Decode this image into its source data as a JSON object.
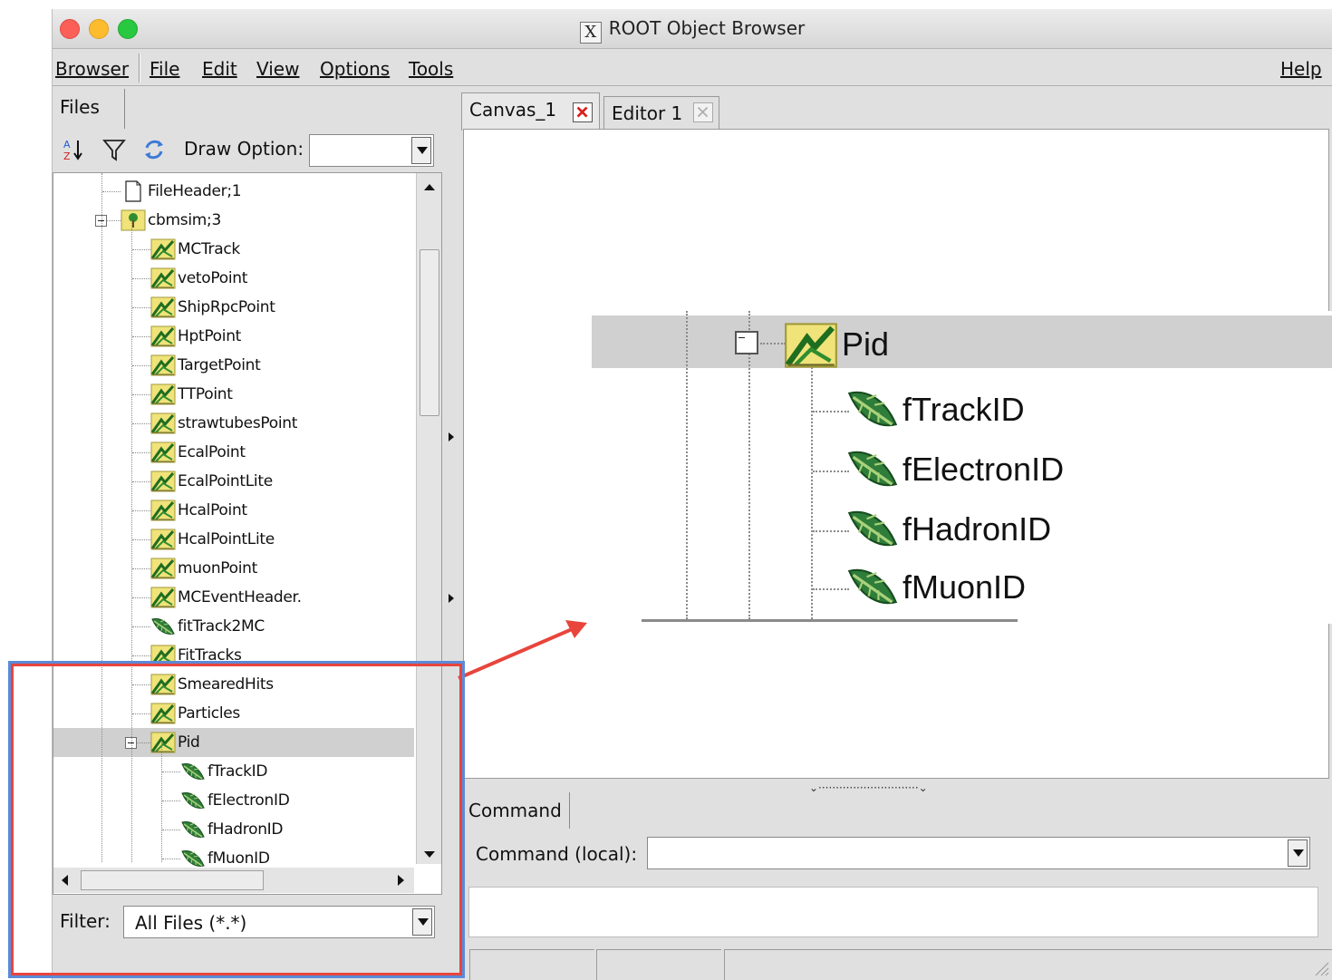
{
  "window": {
    "title": "ROOT Object Browser"
  },
  "menu": {
    "browser": "Browser",
    "file": "File",
    "edit": "Edit",
    "view": "View",
    "options": "Options",
    "tools": "Tools",
    "help": "Help"
  },
  "left": {
    "tab": "Files",
    "draw_option_label": "Draw Option:",
    "draw_option_value": "",
    "filter_label": "Filter:",
    "filter_value": "All Files (*.*)",
    "tree": [
      {
        "label": "FileHeader;1",
        "icon": "file-icon"
      },
      {
        "label": "cbmsim;3",
        "icon": "tree-icon"
      },
      {
        "label": "MCTrack",
        "icon": "branch-icon"
      },
      {
        "label": "vetoPoint",
        "icon": "branch-icon"
      },
      {
        "label": "ShipRpcPoint",
        "icon": "branch-icon"
      },
      {
        "label": "HptPoint",
        "icon": "branch-icon"
      },
      {
        "label": "TargetPoint",
        "icon": "branch-icon"
      },
      {
        "label": "TTPoint",
        "icon": "branch-icon"
      },
      {
        "label": "strawtubesPoint",
        "icon": "branch-icon"
      },
      {
        "label": "EcalPoint",
        "icon": "branch-icon"
      },
      {
        "label": "EcalPointLite",
        "icon": "branch-icon"
      },
      {
        "label": "HcalPoint",
        "icon": "branch-icon"
      },
      {
        "label": "HcalPointLite",
        "icon": "branch-icon"
      },
      {
        "label": "muonPoint",
        "icon": "branch-icon"
      },
      {
        "label": "MCEventHeader.",
        "icon": "branch-icon"
      },
      {
        "label": "fitTrack2MC",
        "icon": "leaf-icon"
      },
      {
        "label": "FitTracks",
        "icon": "branch-icon"
      },
      {
        "label": "SmearedHits",
        "icon": "branch-icon"
      },
      {
        "label": "Particles",
        "icon": "branch-icon"
      },
      {
        "label": "Pid",
        "icon": "branch-icon"
      },
      {
        "label": "fTrackID",
        "icon": "leaf-icon"
      },
      {
        "label": "fElectronID",
        "icon": "leaf-icon"
      },
      {
        "label": "fHadronID",
        "icon": "leaf-icon"
      },
      {
        "label": "fMuonID",
        "icon": "leaf-icon"
      }
    ]
  },
  "right": {
    "tabs": [
      {
        "label": "Canvas_1",
        "close": "active"
      },
      {
        "label": "Editor 1",
        "close": "disabled"
      }
    ],
    "zoom": {
      "parent": "Pid",
      "children": [
        "fTrackID",
        "fElectronID",
        "fHadronID",
        "fMuonID"
      ]
    },
    "command_tab": "Command",
    "command_label": "Command (local):",
    "command_value": ""
  },
  "colors": {
    "annotation_box": "#e8453c",
    "annotation_glow": "#5b8ad8",
    "selection": "#d0d0d0",
    "tab_close_x": "#d81e1e"
  }
}
